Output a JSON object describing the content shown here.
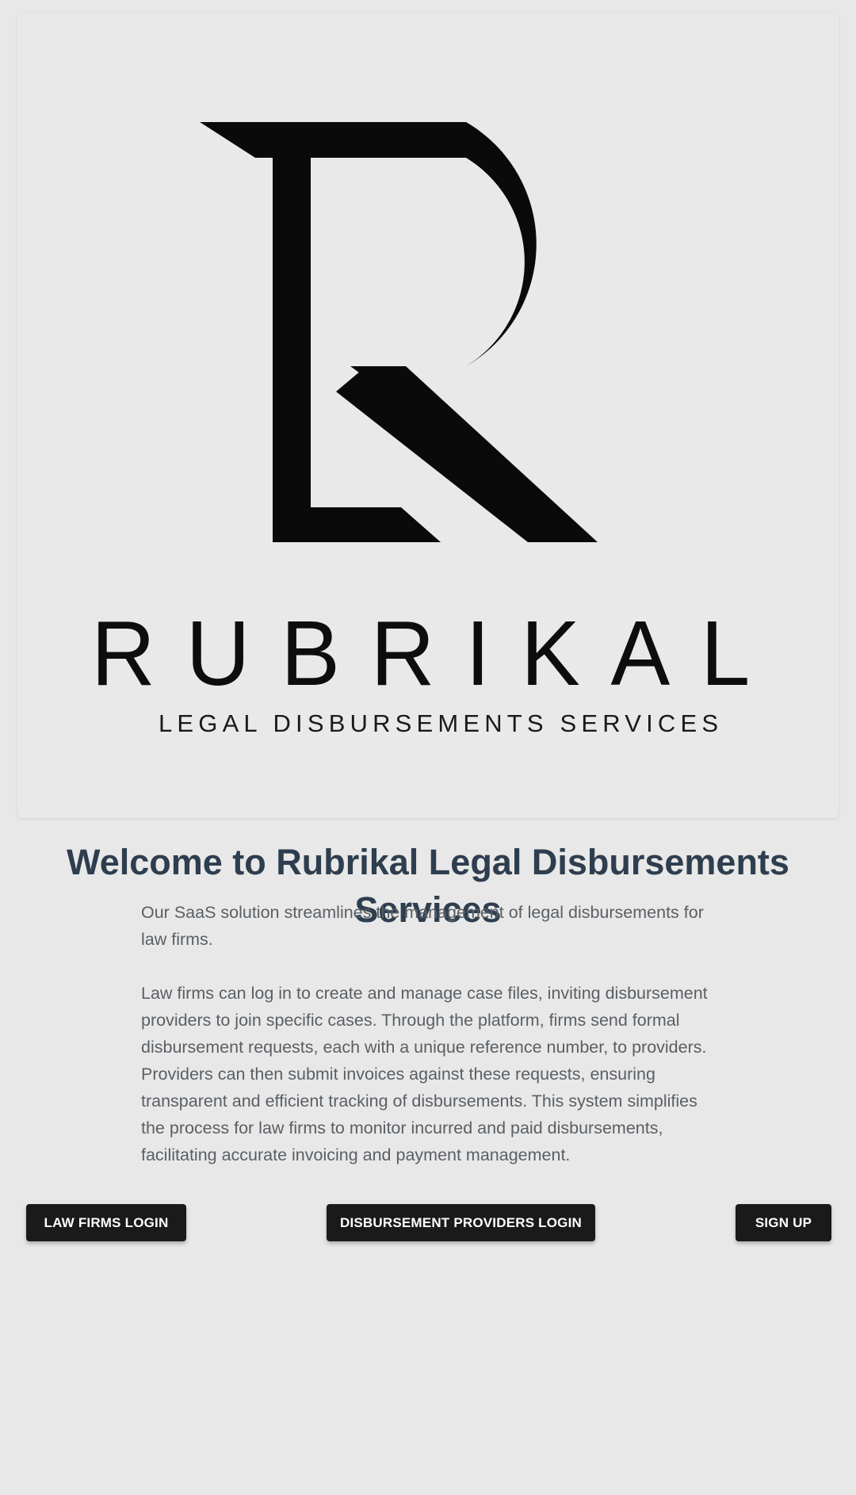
{
  "logo": {
    "brand_name": "RUBRIKAL",
    "tagline": "LEGAL DISBURSEMENTS SERVICES"
  },
  "main": {
    "title": "Welcome to Rubrikal Legal Disbursements Services",
    "paragraph_1": "Our SaaS solution streamlines the management of legal disbursements for law firms.",
    "paragraph_2": "Law firms can log in to create and manage case files, inviting disbursement providers to join specific cases. Through the platform, firms send formal disbursement requests, each with a unique reference number, to providers. Providers can then submit invoices against these requests, ensuring transparent and efficient tracking of disbursements. This system simplifies the process for law firms to monitor incurred and paid disbursements, facilitating accurate invoicing and payment management."
  },
  "actions": {
    "law_firms_login": "LAW FIRMS LOGIN",
    "providers_login": "DISBURSEMENT PROVIDERS LOGIN",
    "sign_up": "SIGN UP"
  },
  "colors": {
    "background": "#e8e8e8",
    "title": "#2e3e4f",
    "body_text": "#5a5f64",
    "button": "#1a1a1a"
  }
}
